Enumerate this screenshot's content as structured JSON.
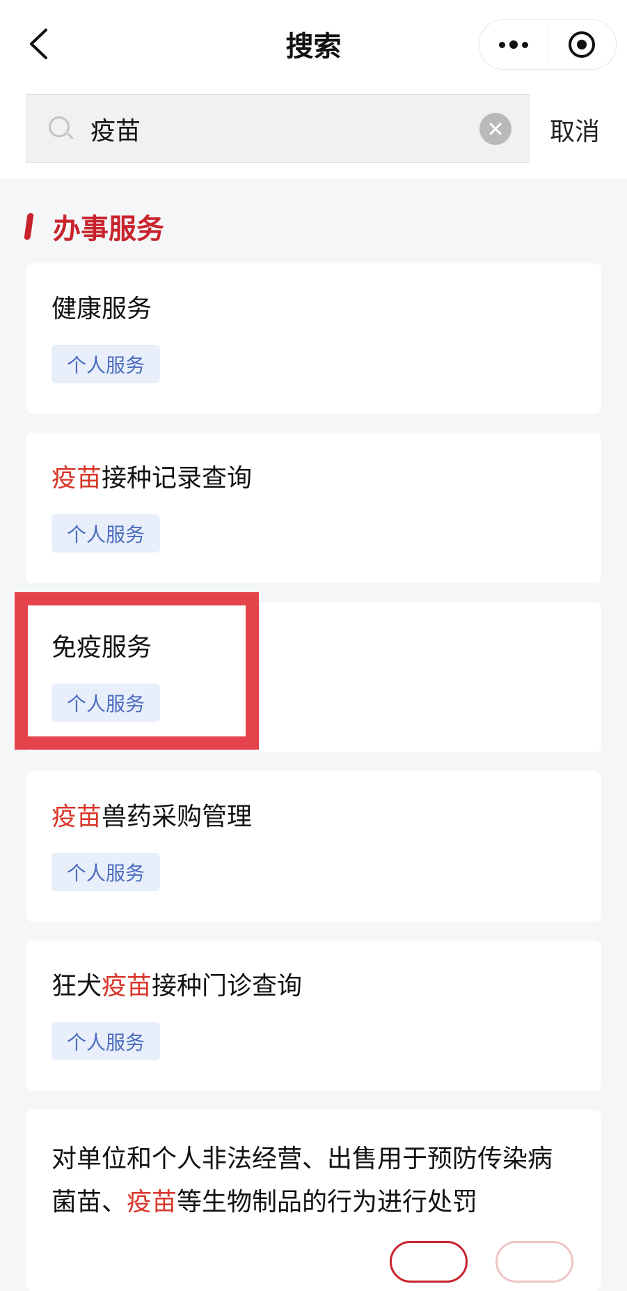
{
  "header": {
    "title": "搜索",
    "icons": {
      "back": "chevron-left-icon",
      "more": "more-dots-icon",
      "close": "target-circle-icon"
    }
  },
  "search": {
    "value": "疫苗",
    "cancel_label": "取消",
    "icons": {
      "search": "search-icon",
      "clear": "clear-icon"
    }
  },
  "section": {
    "title": "办事服务",
    "accent_color": "#c8232c"
  },
  "results": [
    {
      "pre": "",
      "hl": "",
      "post": "健康服务",
      "tag": "个人服务"
    },
    {
      "pre": "",
      "hl": "疫苗",
      "post": "接种记录查询",
      "tag": "个人服务"
    },
    {
      "pre": "",
      "hl": "",
      "post": "免疫服务",
      "tag": "个人服务"
    },
    {
      "pre": "",
      "hl": "疫苗",
      "post": "兽药采购管理",
      "tag": "个人服务"
    },
    {
      "pre": "狂犬",
      "hl": "疫苗",
      "post": "接种门诊查询",
      "tag": "个人服务"
    },
    {
      "line1": "对单位和个人非法经营、出售用于预防传染病",
      "line2_pre": "菌苗、",
      "line2_hl": "疫苗",
      "line2_post": "等生物制品的行为进行处罚"
    }
  ],
  "colors": {
    "highlight_text": "#d9352a",
    "tag_bg": "#e8effb",
    "tag_text": "#4a6bbf",
    "annotation_box": "#e5434b"
  }
}
